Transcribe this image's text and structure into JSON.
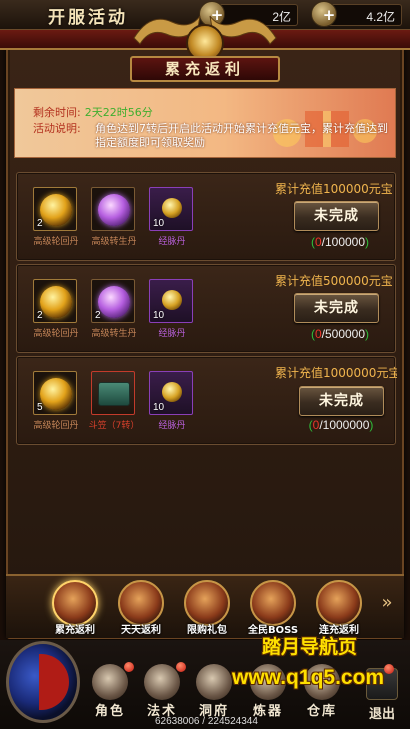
{
  "header": {
    "title": "开服活动",
    "resources": [
      {
        "icon": "ingot-icon",
        "value": "2亿"
      },
      {
        "icon": "gold-bar-icon",
        "value": "4.2亿"
      }
    ]
  },
  "panel": {
    "title": "累充返利",
    "info": {
      "remaining_label": "剩余时间:",
      "remaining_value": "2天22时56分",
      "desc_label": "活动说明:",
      "desc_text": "角色达到7转后开启此活动开始累计充值元宝，累计充值达到指定额度即可领取奖励"
    },
    "rewards": [
      {
        "target": "累计充值100000元宝",
        "button": "未完成",
        "progress_current": "0",
        "progress_total": "/100000",
        "items": [
          {
            "name": "高级轮回丹",
            "qty": "2",
            "icon": "gold-orb-icon"
          },
          {
            "name": "高级转生丹",
            "qty": "",
            "icon": "purple-orb-icon"
          },
          {
            "name": "经脉丹",
            "qty": "10",
            "icon": "meridian-pill-icon"
          }
        ]
      },
      {
        "target": "累计充值500000元宝",
        "button": "未完成",
        "progress_current": "0",
        "progress_total": "/500000",
        "items": [
          {
            "name": "高级轮回丹",
            "qty": "2",
            "icon": "gold-orb-icon"
          },
          {
            "name": "高级转生丹",
            "qty": "2",
            "icon": "purple-orb-icon"
          },
          {
            "name": "经脉丹",
            "qty": "10",
            "icon": "meridian-pill-icon"
          }
        ]
      },
      {
        "target": "累计充值1000000元宝",
        "button": "未完成",
        "progress_current": "0",
        "progress_total": "/1000000",
        "items": [
          {
            "name": "高级轮回丹",
            "qty": "5",
            "icon": "gold-orb-icon"
          },
          {
            "name": "斗笠（7转）",
            "qty": "",
            "icon": "chest-icon"
          },
          {
            "name": "经脉丹",
            "qty": "10",
            "icon": "meridian-pill-icon"
          }
        ]
      }
    ]
  },
  "tabs": [
    {
      "label": "累充返利",
      "active": true
    },
    {
      "label": "天天返利",
      "active": false
    },
    {
      "label": "限购礼包",
      "active": false
    },
    {
      "label": "全民BOSS",
      "active": false
    },
    {
      "label": "连充返利",
      "active": false
    }
  ],
  "actions": [
    {
      "label": "角色",
      "icon": "character-icon"
    },
    {
      "label": "法术",
      "icon": "spell-icon"
    },
    {
      "label": "洞府",
      "icon": "cave-icon"
    },
    {
      "label": "炼器",
      "icon": "forge-icon"
    },
    {
      "label": "仓库",
      "icon": "warehouse-icon"
    },
    {
      "label": "退出",
      "icon": "exit-icon"
    }
  ],
  "status": {
    "exp": "62638006 / 224524344"
  },
  "watermark": {
    "line1": "踏月导航页",
    "line2": "www.q1q5.com"
  },
  "colors": {
    "accent_gold": "#f0b54e",
    "progress_red": "#e8352a",
    "progress_green": "#2fbf3a"
  }
}
